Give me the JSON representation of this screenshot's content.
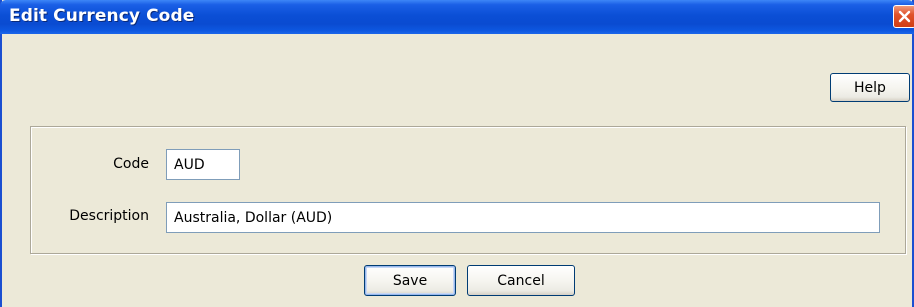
{
  "window": {
    "title": "Edit Currency Code"
  },
  "toolbar": {
    "help_label": "Help"
  },
  "form": {
    "code_label": "Code",
    "code_value": "AUD",
    "description_label": "Description",
    "description_value": "Australia, Dollar (AUD)"
  },
  "actions": {
    "save_label": "Save",
    "cancel_label": "Cancel"
  },
  "icons": {
    "close": "close-icon"
  },
  "colors": {
    "titlebar": "#0b4fd6",
    "close_button": "#e0532c",
    "window_background": "#ece9d8",
    "field_border": "#7f9db9"
  }
}
